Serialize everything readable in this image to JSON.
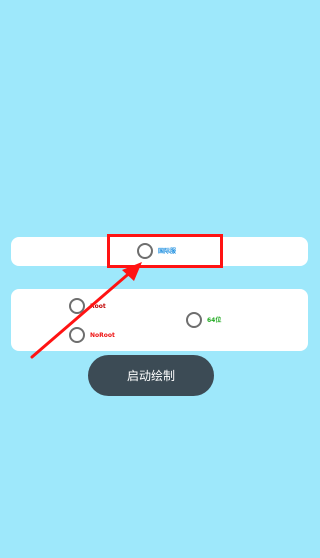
{
  "options": {
    "top_option_label": "国际服",
    "root_label": "Root",
    "noroot_label": "NoRoot",
    "bit64_label": "64位"
  },
  "actions": {
    "start_label": "启动绘制"
  },
  "colors": {
    "background": "#9ee8fb",
    "highlight": "#ff1313",
    "top_label": "#1e8fe0",
    "root_label": "#c00000",
    "noroot_label": "#ee1111",
    "bit64_label": "#22aa22",
    "button": "#3c4b55"
  }
}
